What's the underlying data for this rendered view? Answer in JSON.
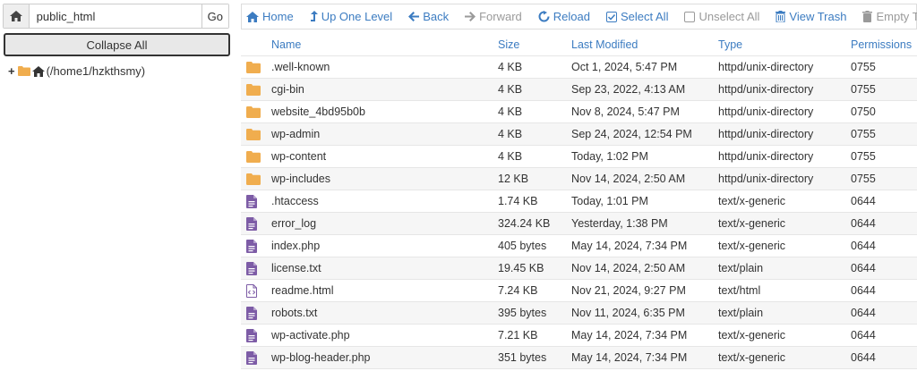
{
  "path_bar": {
    "value": "public_html",
    "go_label": "Go"
  },
  "collapse_label": "Collapse All",
  "tree": {
    "root_label": "(/home1/hzkthsmy)"
  },
  "toolbar": {
    "home": "Home",
    "up": "Up One Level",
    "back": "Back",
    "forward": "Forward",
    "reload": "Reload",
    "select_all": "Select All",
    "unselect_all": "Unselect All",
    "view_trash": "View Trash",
    "empty_trash": "Empty Trash"
  },
  "columns": {
    "name": "Name",
    "size": "Size",
    "modified": "Last Modified",
    "type": "Type",
    "permissions": "Permissions"
  },
  "files": [
    {
      "icon": "folder",
      "name": ".well-known",
      "size": "4 KB",
      "modified": "Oct 1, 2024, 5:47 PM",
      "type": "httpd/unix-directory",
      "perm": "0755"
    },
    {
      "icon": "folder",
      "name": "cgi-bin",
      "size": "4 KB",
      "modified": "Sep 23, 2022, 4:13 AM",
      "type": "httpd/unix-directory",
      "perm": "0755"
    },
    {
      "icon": "folder",
      "name": "website_4bd95b0b",
      "size": "4 KB",
      "modified": "Nov 8, 2024, 5:47 PM",
      "type": "httpd/unix-directory",
      "perm": "0750"
    },
    {
      "icon": "folder",
      "name": "wp-admin",
      "size": "4 KB",
      "modified": "Sep 24, 2024, 12:54 PM",
      "type": "httpd/unix-directory",
      "perm": "0755"
    },
    {
      "icon": "folder",
      "name": "wp-content",
      "size": "4 KB",
      "modified": "Today, 1:02 PM",
      "type": "httpd/unix-directory",
      "perm": "0755"
    },
    {
      "icon": "folder",
      "name": "wp-includes",
      "size": "12 KB",
      "modified": "Nov 14, 2024, 2:50 AM",
      "type": "httpd/unix-directory",
      "perm": "0755"
    },
    {
      "icon": "file",
      "name": ".htaccess",
      "size": "1.74 KB",
      "modified": "Today, 1:01 PM",
      "type": "text/x-generic",
      "perm": "0644"
    },
    {
      "icon": "file",
      "name": "error_log",
      "size": "324.24 KB",
      "modified": "Yesterday, 1:38 PM",
      "type": "text/x-generic",
      "perm": "0644"
    },
    {
      "icon": "file",
      "name": "index.php",
      "size": "405 bytes",
      "modified": "May 14, 2024, 7:34 PM",
      "type": "text/x-generic",
      "perm": "0644"
    },
    {
      "icon": "file",
      "name": "license.txt",
      "size": "19.45 KB",
      "modified": "Nov 14, 2024, 2:50 AM",
      "type": "text/plain",
      "perm": "0644"
    },
    {
      "icon": "html",
      "name": "readme.html",
      "size": "7.24 KB",
      "modified": "Nov 21, 2024, 9:27 PM",
      "type": "text/html",
      "perm": "0644"
    },
    {
      "icon": "file",
      "name": "robots.txt",
      "size": "395 bytes",
      "modified": "Nov 11, 2024, 6:35 PM",
      "type": "text/plain",
      "perm": "0644"
    },
    {
      "icon": "file",
      "name": "wp-activate.php",
      "size": "7.21 KB",
      "modified": "May 14, 2024, 7:34 PM",
      "type": "text/x-generic",
      "perm": "0644"
    },
    {
      "icon": "file",
      "name": "wp-blog-header.php",
      "size": "351 bytes",
      "modified": "May 14, 2024, 7:34 PM",
      "type": "text/x-generic",
      "perm": "0644"
    }
  ],
  "colors": {
    "link": "#3c7cc1",
    "folder": "#f0ad4e",
    "file": "#7d5ca6"
  }
}
